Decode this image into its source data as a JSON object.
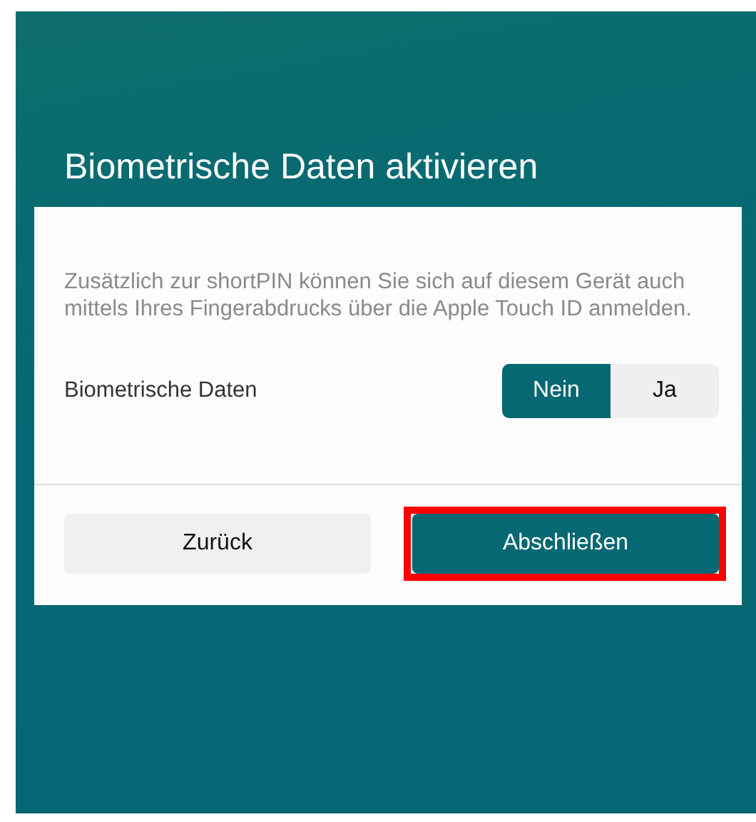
{
  "title": "Biometrische Daten aktivieren",
  "description": "Zusätzlich zur shortPIN können Sie sich auf diesem Gerät auch mittels Ihres Fingerabdrucks über die Apple Touch ID anmelden.",
  "setting": {
    "label": "Biometrische Daten",
    "options": [
      {
        "label": "Nein",
        "selected": true
      },
      {
        "label": "Ja",
        "selected": false
      }
    ]
  },
  "buttons": [
    {
      "label": "Zurück",
      "kind": "secondary",
      "highlighted": false
    },
    {
      "label": "Abschließen",
      "kind": "primary",
      "highlighted": true
    }
  ]
}
